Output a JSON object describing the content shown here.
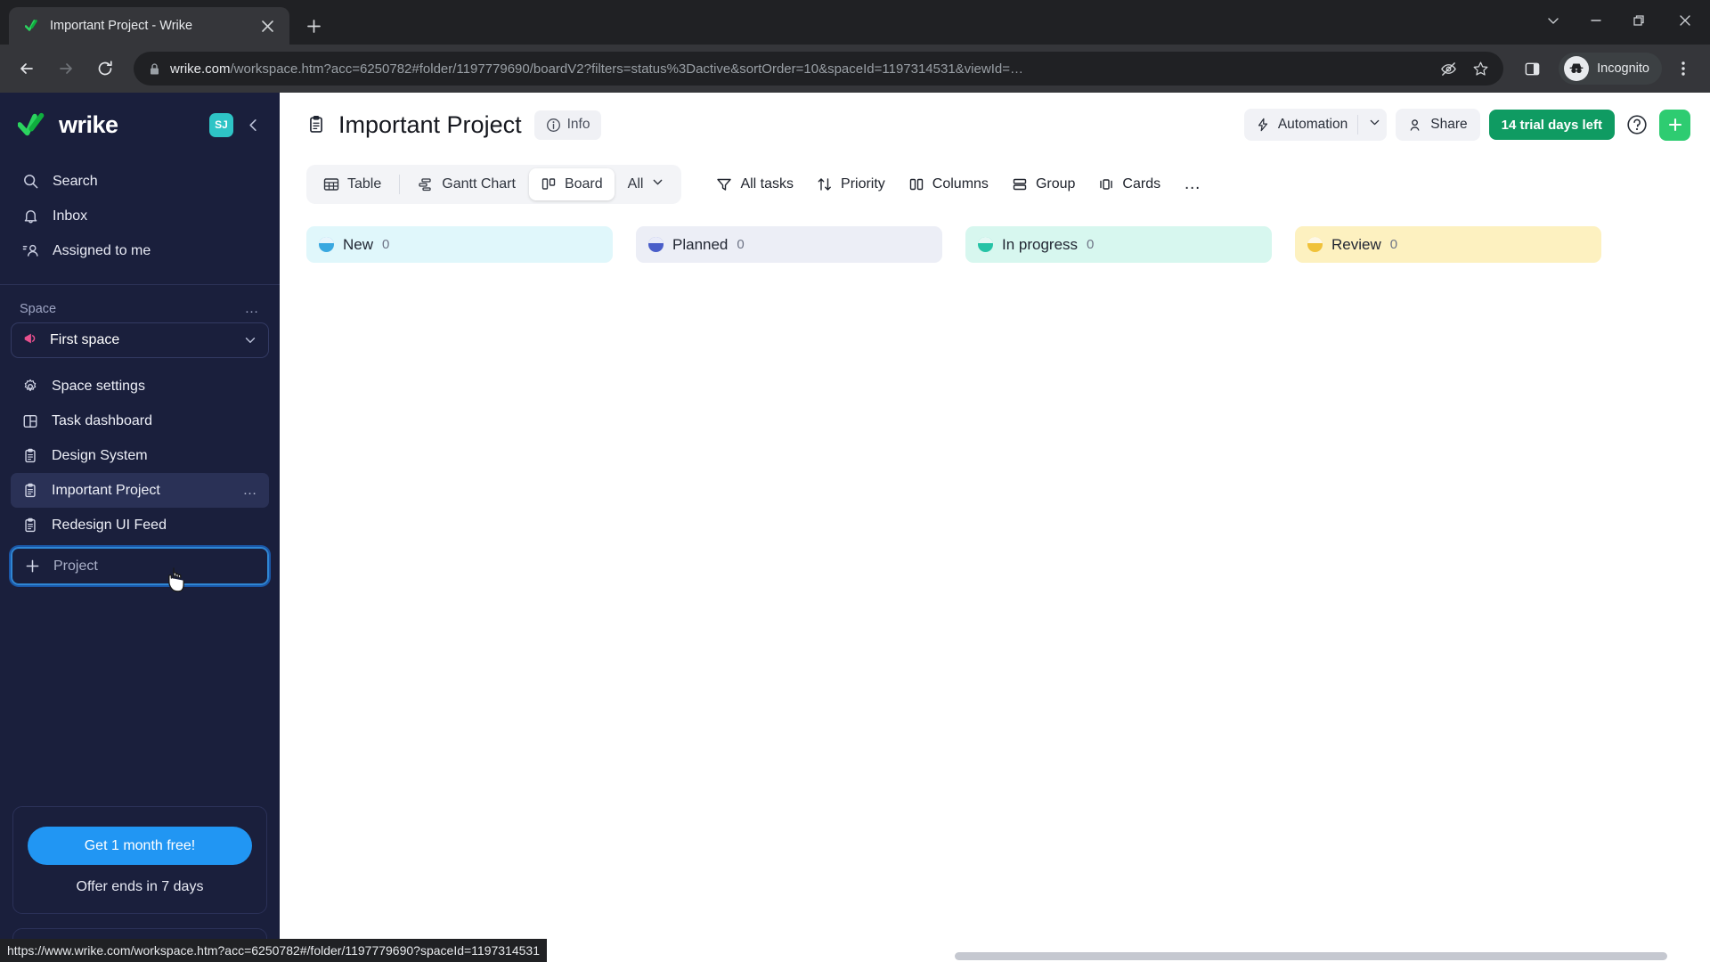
{
  "browser": {
    "tab": {
      "title": "Important Project - Wrike",
      "favicon": "wrike-check-icon",
      "close": "close-icon"
    },
    "new_tab_label": "+",
    "window_controls": {
      "expand": "chevron-down-icon",
      "minimize": "minimize-icon",
      "maximize": "maximize-icon",
      "close": "close-icon"
    },
    "nav": {
      "back": "back-arrow-icon",
      "forward": "forward-arrow-icon",
      "reload": "reload-icon"
    },
    "omnibox": {
      "lock": "lock-icon",
      "url_domain": "wrike.com",
      "url_path": "/workspace.htm?acc=6250782#folder/1197779690/boardV2?filters=status%3Dactive&sortOrder=10&spaceId=1197314531&viewId=…",
      "tracking_protection": "eye-slash-icon",
      "bookmark": "star-icon"
    },
    "side_panel": "side-panel-icon",
    "profile": {
      "label": "Incognito",
      "avatar": "incognito-hat-icon"
    },
    "menu": "three-dot-menu-icon"
  },
  "statusbar": {
    "url": "https://www.wrike.com/workspace.htm?acc=6250782#/folder/1197779690?spaceId=1197314531"
  },
  "sidebar": {
    "logo_text": "wrike",
    "avatar_initials": "SJ",
    "collapse": "chevron-left-icon",
    "nav": [
      {
        "label": "Search",
        "icon": "search-icon"
      },
      {
        "label": "Inbox",
        "icon": "bell-icon"
      },
      {
        "label": "Assigned to me",
        "icon": "assigned-user-icon"
      }
    ],
    "space_section_label": "Space",
    "space_section_more": "…",
    "space": {
      "label": "First space",
      "icon": "megaphone-icon",
      "chevron": "chevron-down-icon"
    },
    "links": [
      {
        "label": "Space settings",
        "icon": "gear-icon",
        "active": false,
        "more": false
      },
      {
        "label": "Task dashboard",
        "icon": "dashboard-icon",
        "active": false,
        "more": false
      },
      {
        "label": "Design System",
        "icon": "clipboard-icon",
        "active": false,
        "more": false
      },
      {
        "label": "Important Project",
        "icon": "clipboard-icon",
        "active": true,
        "more": true
      },
      {
        "label": "Redesign UI Feed",
        "icon": "clipboard-icon",
        "active": false,
        "more": false
      }
    ],
    "add_project": {
      "label": "Project",
      "icon": "plus-icon"
    },
    "promo": {
      "button": "Get 1 month free!",
      "subtext": "Offer ends in 7 days"
    }
  },
  "header": {
    "project_icon": "clipboard-icon",
    "title": "Important Project",
    "info": {
      "label": "Info",
      "icon": "info-circle-icon"
    },
    "automation": {
      "label": "Automation",
      "icon": "lightning-icon",
      "chevron": "chevron-down-icon"
    },
    "share": {
      "label": "Share",
      "icon": "person-add-icon"
    },
    "trial": "14 trial days left",
    "help": "question-circle-icon",
    "add": "plus-icon"
  },
  "viewbar": {
    "views": [
      {
        "label": "Table",
        "icon": "table-icon",
        "active": false
      },
      {
        "label": "Gantt Chart",
        "icon": "gantt-icon",
        "active": false
      },
      {
        "label": "Board",
        "icon": "board-icon",
        "active": true
      }
    ],
    "all_dropdown": {
      "label": "All",
      "chevron": "chevron-down-icon"
    },
    "tools": [
      {
        "label": "All tasks",
        "icon": "filter-icon"
      },
      {
        "label": "Priority",
        "icon": "sort-arrows-icon"
      },
      {
        "label": "Columns",
        "icon": "columns-icon"
      },
      {
        "label": "Group",
        "icon": "group-rows-icon"
      },
      {
        "label": "Cards",
        "icon": "cards-icon"
      }
    ],
    "more": "…"
  },
  "board": {
    "columns": [
      {
        "label": "New",
        "count": "0",
        "bg": "#e0f7fb",
        "dot": "#3aa8e0"
      },
      {
        "label": "Planned",
        "count": "0",
        "bg": "#eceef6",
        "dot": "#4a5ec9"
      },
      {
        "label": "In progress",
        "count": "0",
        "bg": "#d7f7ef",
        "dot": "#26c3a6"
      },
      {
        "label": "Review",
        "count": "0",
        "bg": "#fdf1c0",
        "dot": "#f0c23a"
      }
    ]
  }
}
